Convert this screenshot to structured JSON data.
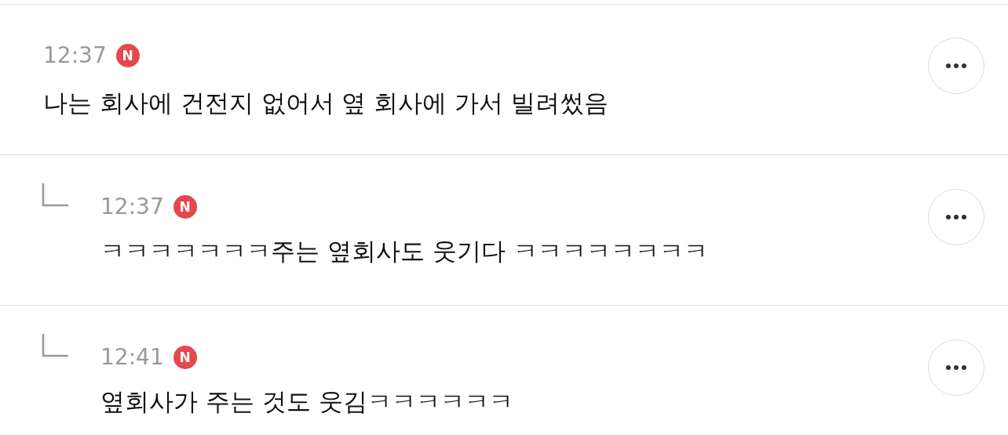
{
  "comments": [
    {
      "kind": "comment",
      "time": "12:37",
      "badge": "N",
      "text": "나는 회사에 건전지 없어서 옆 회사에 가서 빌려썼음"
    },
    {
      "kind": "reply",
      "time": "12:37",
      "badge": "N",
      "text": "ㅋㅋㅋㅋㅋㅋㅋ주는 옆회사도 웃기다 ㅋㅋㅋㅋㅋㅋㅋㅋ"
    },
    {
      "kind": "reply",
      "time": "12:41",
      "badge": "N",
      "text": "옆회사가 주는 것도 웃김ㅋㅋㅋㅋㅋㅋ"
    }
  ]
}
